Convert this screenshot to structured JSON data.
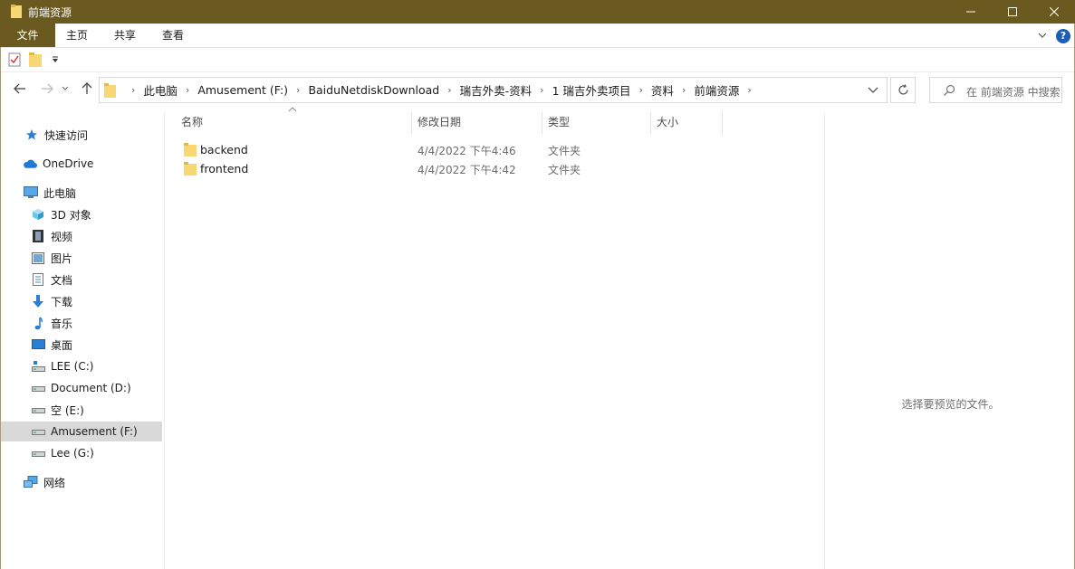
{
  "window": {
    "title": "前端资源"
  },
  "ribbon": {
    "tabs": [
      {
        "label": "文件"
      },
      {
        "label": "主页"
      },
      {
        "label": "共享"
      },
      {
        "label": "查看"
      }
    ],
    "help": "?"
  },
  "address": {
    "breadcrumbs": [
      "此电脑",
      "Amusement (F:)",
      "BaiduNetdiskDownload",
      "瑞吉外卖-资料",
      "1 瑞吉外卖项目",
      "资料",
      "前端资源"
    ]
  },
  "search": {
    "placeholder": "在 前端资源 中搜索"
  },
  "sidebar": {
    "items": [
      {
        "label": "快速访问",
        "icon": "star-icon"
      },
      {
        "label": "OneDrive",
        "icon": "cloud-icon"
      },
      {
        "label": "此电脑",
        "icon": "computer-icon"
      },
      {
        "label": "3D 对象",
        "icon": "cube-icon"
      },
      {
        "label": "视频",
        "icon": "film-icon"
      },
      {
        "label": "图片",
        "icon": "picture-icon"
      },
      {
        "label": "文档",
        "icon": "document-icon"
      },
      {
        "label": "下载",
        "icon": "download-icon"
      },
      {
        "label": "音乐",
        "icon": "music-icon"
      },
      {
        "label": "桌面",
        "icon": "desktop-icon"
      },
      {
        "label": "LEE (C:)",
        "icon": "system-drive-icon"
      },
      {
        "label": "Document (D:)",
        "icon": "drive-icon"
      },
      {
        "label": "空 (E:)",
        "icon": "drive-icon"
      },
      {
        "label": "Amusement (F:)",
        "icon": "drive-icon",
        "selected": true
      },
      {
        "label": "Lee (G:)",
        "icon": "drive-icon"
      },
      {
        "label": "网络",
        "icon": "network-icon"
      }
    ]
  },
  "columns": {
    "name": "名称",
    "date": "修改日期",
    "type": "类型",
    "size": "大小"
  },
  "files": [
    {
      "name": "backend",
      "date": "4/4/2022 下午4:46",
      "type": "文件夹"
    },
    {
      "name": "frontend",
      "date": "4/4/2022 下午4:42",
      "type": "文件夹"
    }
  ],
  "preview": {
    "message": "选择要预览的文件。"
  },
  "colors": {
    "accent": "#6b5a1f",
    "folder": "#f8d775",
    "selection": "#d9d9d9"
  }
}
